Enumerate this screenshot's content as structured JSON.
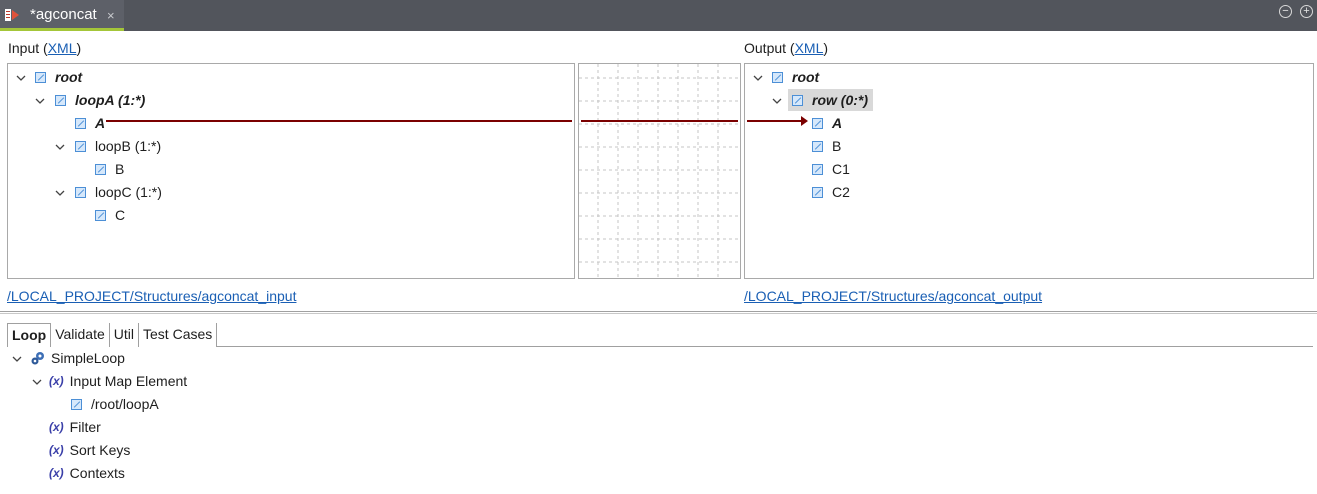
{
  "editor": {
    "tab_title": "*agconcat",
    "close_glyph": "×",
    "minimize_glyph": "−",
    "maximize_glyph": "+"
  },
  "input": {
    "label": "Input (",
    "format": "XML",
    "label_end": ")",
    "path": "/LOCAL_PROJECT/Structures/agconcat_input",
    "tree": {
      "root": "root",
      "loopA": "loopA (1:*)",
      "A": "A",
      "loopB": "loopB (1:*)",
      "B": "B",
      "loopC": "loopC (1:*)",
      "C": "C"
    }
  },
  "output": {
    "label": "Output (",
    "format": "XML",
    "label_end": ")",
    "path": "/LOCAL_PROJECT/Structures/agconcat_output",
    "tree": {
      "root": "root",
      "row": "row (0:*)",
      "A": "A",
      "B": "B",
      "C1": "C1",
      "C2": "C2"
    }
  },
  "bottom": {
    "tabs": [
      "Loop",
      "Validate",
      "Util",
      "Test Cases"
    ],
    "tree": {
      "simple_loop": "SimpleLoop",
      "input_map_element": "Input Map Element",
      "path": "/root/loopA",
      "filter": "Filter",
      "sort_keys": "Sort Keys",
      "contexts": "Contexts",
      "expr_glyph": "(x)"
    }
  },
  "colors": {
    "mapping_line": "#7b0000",
    "tab_accent": "#a4c639",
    "link": "#1a5fb4"
  },
  "icons": [
    "file-icon",
    "chevron-down-icon",
    "element-icon",
    "loop-icon",
    "variable-icon"
  ]
}
